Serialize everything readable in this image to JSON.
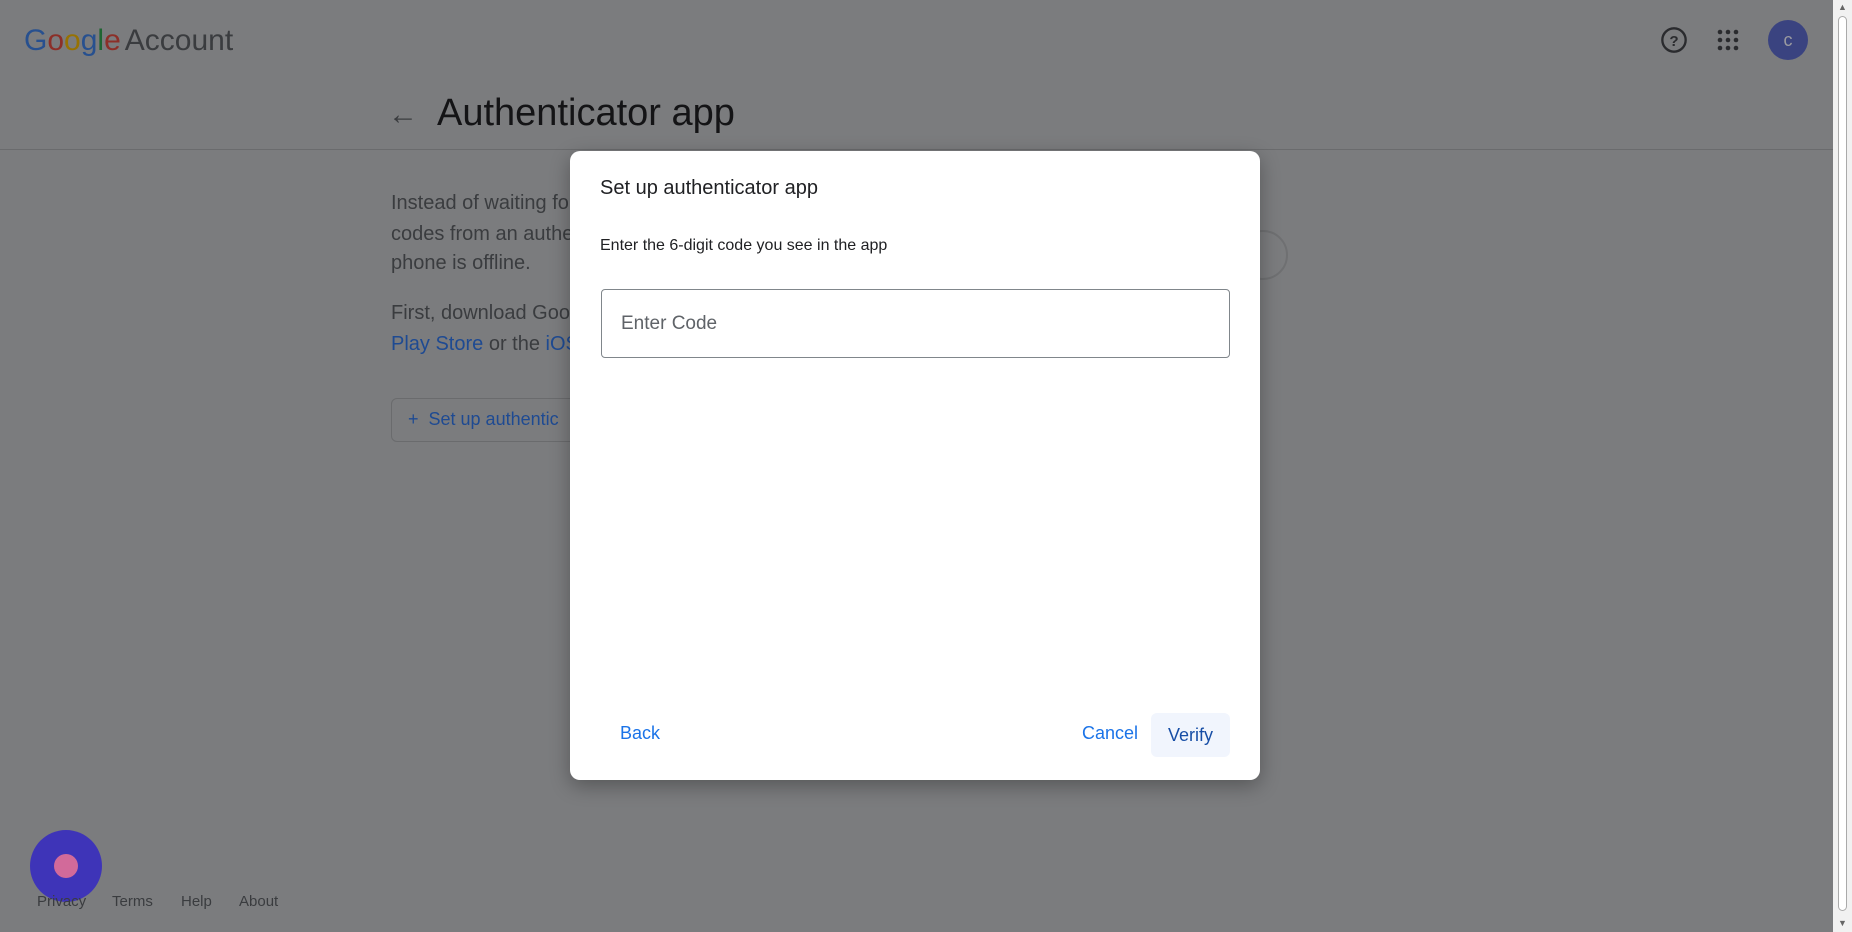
{
  "header": {
    "logo_google": "Google",
    "logo_account": "Account",
    "avatar_letter": "c",
    "help_icon": "help-circle-icon",
    "apps_icon": "apps-grid-icon"
  },
  "page": {
    "title": "Authenticator app",
    "para1": [
      "Instead of waiting fo",
      "codes from an authe",
      "phone is offline."
    ],
    "para2_line1": "First, download Goo",
    "para2_link1": "Play Store",
    "para2_mid": " or the ",
    "para2_link2": "iOS",
    "setup_button": "Set up authentic"
  },
  "footer": {
    "links": [
      "Privacy",
      "Terms",
      "Help",
      "About"
    ]
  },
  "dialog": {
    "title": "Set up authenticator app",
    "subtitle": "Enter the 6-digit code you see in the app",
    "input_placeholder": "Enter Code",
    "input_value": "",
    "back": "Back",
    "cancel": "Cancel",
    "verify": "Verify"
  }
}
